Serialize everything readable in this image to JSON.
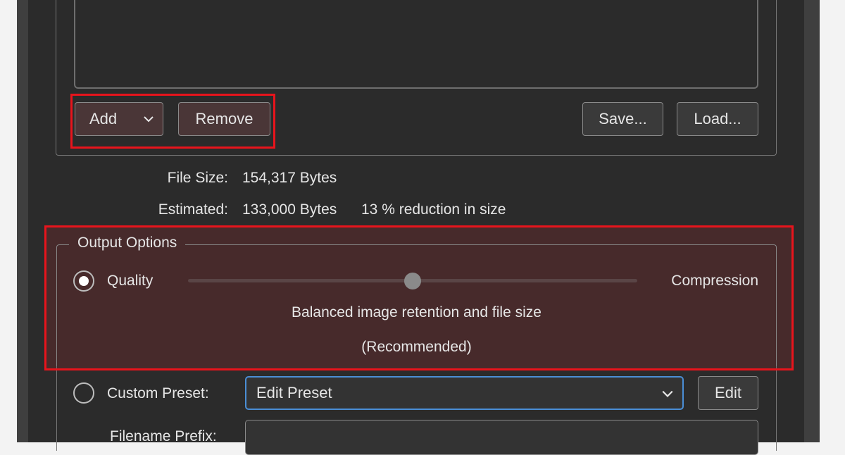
{
  "buttons": {
    "add": "Add",
    "remove": "Remove",
    "save": "Save...",
    "load": "Load...",
    "edit": "Edit"
  },
  "file_info": {
    "file_size_label": "File Size:",
    "file_size_value": "154,317 Bytes",
    "estimated_label": "Estimated:",
    "estimated_value": "133,000 Bytes",
    "reduction": "13 % reduction in size"
  },
  "output_options": {
    "legend": "Output Options",
    "quality_label": "Quality",
    "compression_label": "Compression",
    "slider_value_fraction": 0.5,
    "description_line1": "Balanced image retention and file size",
    "description_line2": "(Recommended)",
    "quality_selected": true
  },
  "custom_preset": {
    "label": "Custom Preset:",
    "selected": "Edit Preset",
    "radio_selected": false
  },
  "filename_prefix": {
    "label": "Filename Prefix:",
    "value": ""
  },
  "icons": {
    "dropdown": "chevron-down-icon"
  },
  "colors": {
    "highlight": "#e8141c",
    "focus_border": "#4a8ed6",
    "dialog_bg": "#2b2b2b"
  }
}
